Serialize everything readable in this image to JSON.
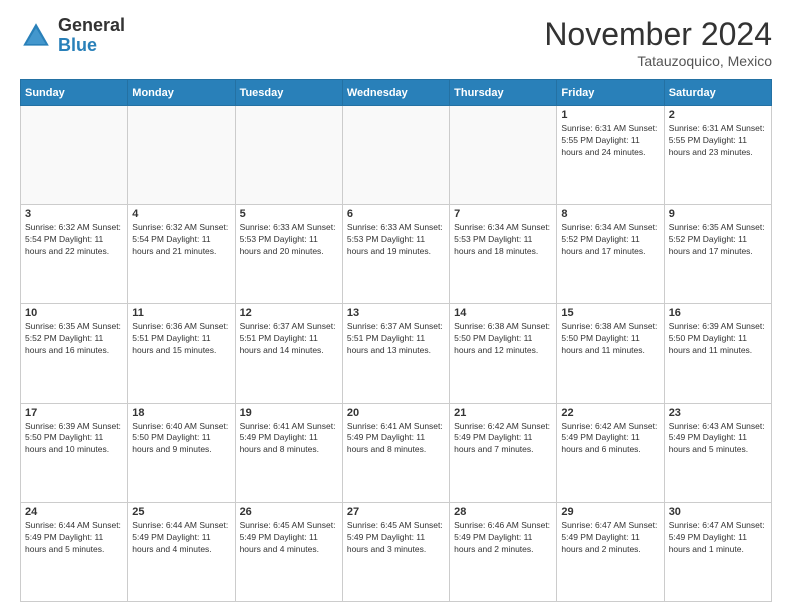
{
  "logo": {
    "general": "General",
    "blue": "Blue"
  },
  "header": {
    "month": "November 2024",
    "location": "Tatauzoquico, Mexico"
  },
  "weekdays": [
    "Sunday",
    "Monday",
    "Tuesday",
    "Wednesday",
    "Thursday",
    "Friday",
    "Saturday"
  ],
  "weeks": [
    [
      {
        "day": "",
        "info": ""
      },
      {
        "day": "",
        "info": ""
      },
      {
        "day": "",
        "info": ""
      },
      {
        "day": "",
        "info": ""
      },
      {
        "day": "",
        "info": ""
      },
      {
        "day": "1",
        "info": "Sunrise: 6:31 AM\nSunset: 5:55 PM\nDaylight: 11 hours and 24 minutes."
      },
      {
        "day": "2",
        "info": "Sunrise: 6:31 AM\nSunset: 5:55 PM\nDaylight: 11 hours and 23 minutes."
      }
    ],
    [
      {
        "day": "3",
        "info": "Sunrise: 6:32 AM\nSunset: 5:54 PM\nDaylight: 11 hours and 22 minutes."
      },
      {
        "day": "4",
        "info": "Sunrise: 6:32 AM\nSunset: 5:54 PM\nDaylight: 11 hours and 21 minutes."
      },
      {
        "day": "5",
        "info": "Sunrise: 6:33 AM\nSunset: 5:53 PM\nDaylight: 11 hours and 20 minutes."
      },
      {
        "day": "6",
        "info": "Sunrise: 6:33 AM\nSunset: 5:53 PM\nDaylight: 11 hours and 19 minutes."
      },
      {
        "day": "7",
        "info": "Sunrise: 6:34 AM\nSunset: 5:53 PM\nDaylight: 11 hours and 18 minutes."
      },
      {
        "day": "8",
        "info": "Sunrise: 6:34 AM\nSunset: 5:52 PM\nDaylight: 11 hours and 17 minutes."
      },
      {
        "day": "9",
        "info": "Sunrise: 6:35 AM\nSunset: 5:52 PM\nDaylight: 11 hours and 17 minutes."
      }
    ],
    [
      {
        "day": "10",
        "info": "Sunrise: 6:35 AM\nSunset: 5:52 PM\nDaylight: 11 hours and 16 minutes."
      },
      {
        "day": "11",
        "info": "Sunrise: 6:36 AM\nSunset: 5:51 PM\nDaylight: 11 hours and 15 minutes."
      },
      {
        "day": "12",
        "info": "Sunrise: 6:37 AM\nSunset: 5:51 PM\nDaylight: 11 hours and 14 minutes."
      },
      {
        "day": "13",
        "info": "Sunrise: 6:37 AM\nSunset: 5:51 PM\nDaylight: 11 hours and 13 minutes."
      },
      {
        "day": "14",
        "info": "Sunrise: 6:38 AM\nSunset: 5:50 PM\nDaylight: 11 hours and 12 minutes."
      },
      {
        "day": "15",
        "info": "Sunrise: 6:38 AM\nSunset: 5:50 PM\nDaylight: 11 hours and 11 minutes."
      },
      {
        "day": "16",
        "info": "Sunrise: 6:39 AM\nSunset: 5:50 PM\nDaylight: 11 hours and 11 minutes."
      }
    ],
    [
      {
        "day": "17",
        "info": "Sunrise: 6:39 AM\nSunset: 5:50 PM\nDaylight: 11 hours and 10 minutes."
      },
      {
        "day": "18",
        "info": "Sunrise: 6:40 AM\nSunset: 5:50 PM\nDaylight: 11 hours and 9 minutes."
      },
      {
        "day": "19",
        "info": "Sunrise: 6:41 AM\nSunset: 5:49 PM\nDaylight: 11 hours and 8 minutes."
      },
      {
        "day": "20",
        "info": "Sunrise: 6:41 AM\nSunset: 5:49 PM\nDaylight: 11 hours and 8 minutes."
      },
      {
        "day": "21",
        "info": "Sunrise: 6:42 AM\nSunset: 5:49 PM\nDaylight: 11 hours and 7 minutes."
      },
      {
        "day": "22",
        "info": "Sunrise: 6:42 AM\nSunset: 5:49 PM\nDaylight: 11 hours and 6 minutes."
      },
      {
        "day": "23",
        "info": "Sunrise: 6:43 AM\nSunset: 5:49 PM\nDaylight: 11 hours and 5 minutes."
      }
    ],
    [
      {
        "day": "24",
        "info": "Sunrise: 6:44 AM\nSunset: 5:49 PM\nDaylight: 11 hours and 5 minutes."
      },
      {
        "day": "25",
        "info": "Sunrise: 6:44 AM\nSunset: 5:49 PM\nDaylight: 11 hours and 4 minutes."
      },
      {
        "day": "26",
        "info": "Sunrise: 6:45 AM\nSunset: 5:49 PM\nDaylight: 11 hours and 4 minutes."
      },
      {
        "day": "27",
        "info": "Sunrise: 6:45 AM\nSunset: 5:49 PM\nDaylight: 11 hours and 3 minutes."
      },
      {
        "day": "28",
        "info": "Sunrise: 6:46 AM\nSunset: 5:49 PM\nDaylight: 11 hours and 2 minutes."
      },
      {
        "day": "29",
        "info": "Sunrise: 6:47 AM\nSunset: 5:49 PM\nDaylight: 11 hours and 2 minutes."
      },
      {
        "day": "30",
        "info": "Sunrise: 6:47 AM\nSunset: 5:49 PM\nDaylight: 11 hours and 1 minute."
      }
    ]
  ]
}
